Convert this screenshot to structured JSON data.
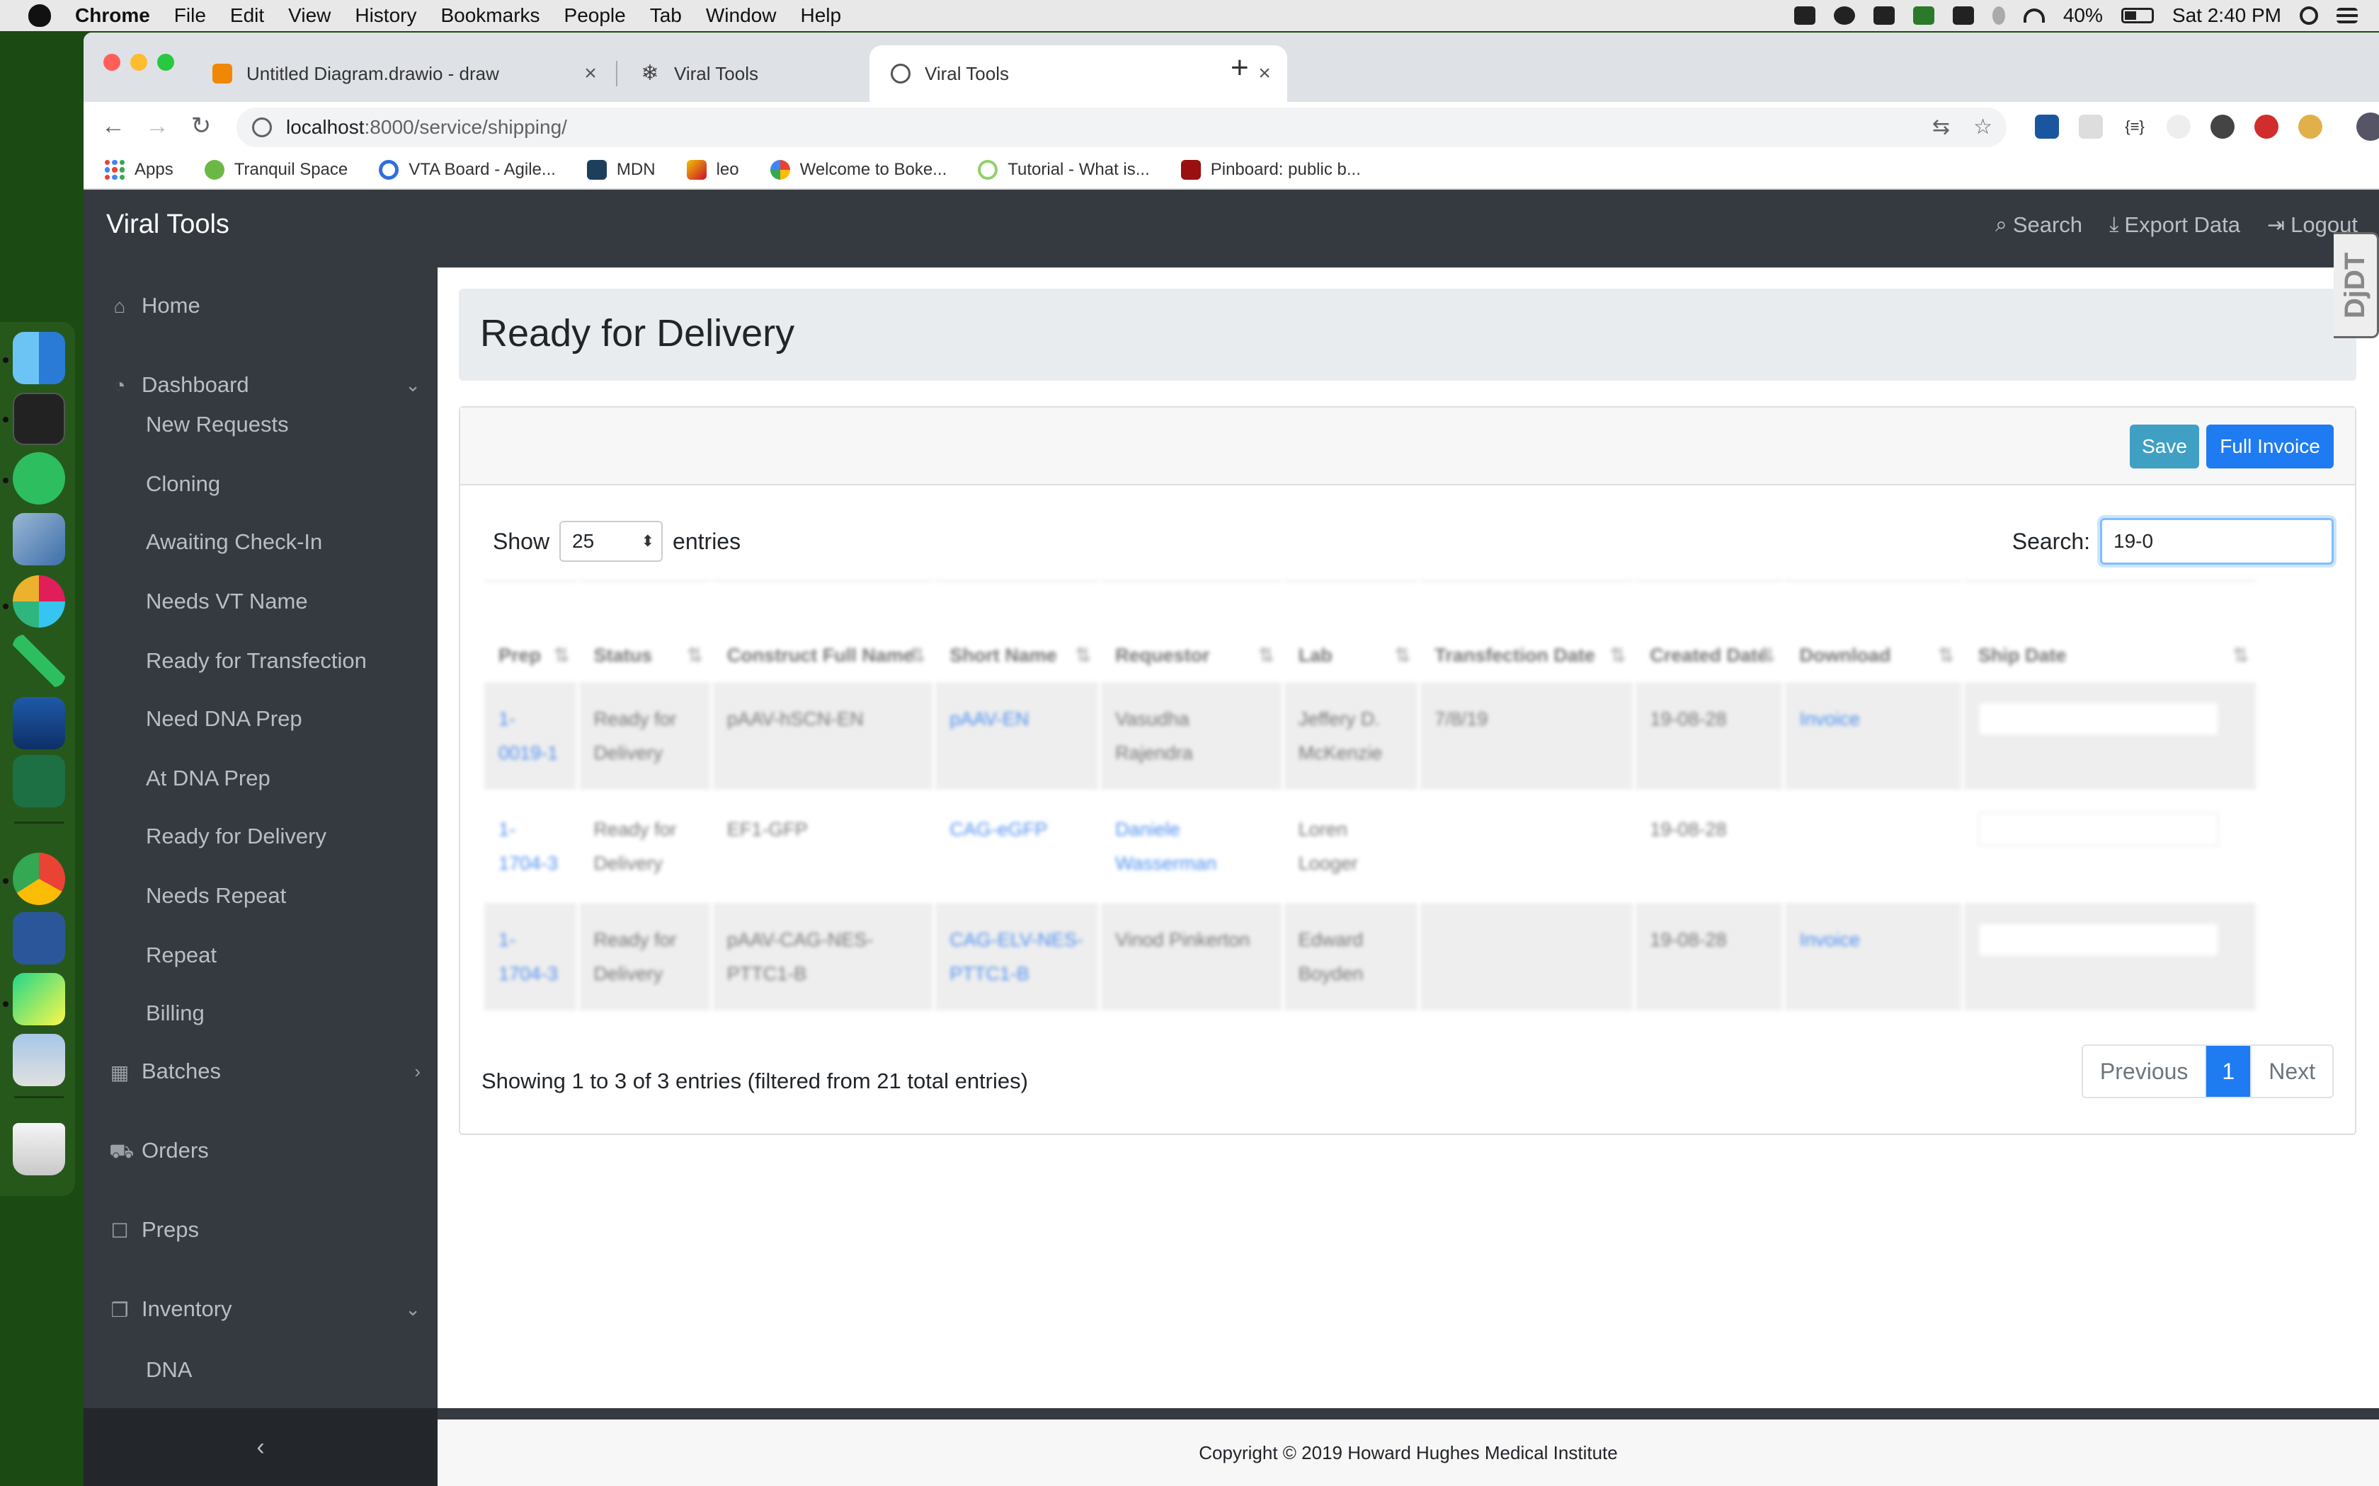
{
  "menubar": {
    "app": "Chrome",
    "items": [
      "File",
      "Edit",
      "View",
      "History",
      "Bookmarks",
      "People",
      "Tab",
      "Window",
      "Help"
    ],
    "battery": "40%",
    "clock": "Sat 2:40 PM"
  },
  "browser": {
    "tabs": [
      {
        "label": "Untitled Diagram.drawio - draw"
      },
      {
        "label": "Viral Tools"
      },
      {
        "label": "Viral Tools"
      }
    ],
    "url_host": "localhost",
    "url_path": ":8000/service/shipping/",
    "bookmarks": [
      "Apps",
      "Tranquil Space",
      "VTA Board - Agile...",
      "MDN",
      "leo",
      "Welcome to Boke...",
      "Tutorial - What is...",
      "Pinboard: public b..."
    ]
  },
  "app": {
    "brand": "Viral Tools",
    "nav": {
      "search": "Search",
      "export": "Export Data",
      "logout": "Logout"
    },
    "ddt": "DjDT"
  },
  "sidebar": {
    "home": "Home",
    "dashboard": "Dashboard",
    "dashboard_items": [
      "New Requests",
      "Cloning",
      "Awaiting Check-In",
      "Needs VT Name",
      "Ready for Transfection",
      "Need DNA Prep",
      "At DNA Prep",
      "Ready for Delivery",
      "Needs Repeat",
      "Repeat",
      "Billing"
    ],
    "batches": "Batches",
    "orders": "Orders",
    "preps": "Preps",
    "inventory": "Inventory",
    "inventory_items": [
      "DNA"
    ],
    "collapse": "‹"
  },
  "page": {
    "title": "Ready for Delivery",
    "save": "Save",
    "full_invoice": "Full Invoice",
    "show_label": "Show",
    "page_length": "25",
    "entries_label": "entries",
    "search_label": "Search:",
    "search_value": "19-0",
    "table": {
      "headers": [
        "Prep",
        "Status",
        "Construct Full Name",
        "Short Name",
        "Requestor",
        "Lab",
        "Transfection Date",
        "Created Date",
        "Download",
        "Ship Date"
      ],
      "rows": [
        [
          "1-0019-1",
          "Ready for Delivery",
          "pAAV-hSCN-EN",
          "pAAV-EN",
          "Vasudha Rajendra",
          "Jeffery D. McKenzie",
          "7/8/19",
          "19-08-28",
          "Invoice",
          ""
        ],
        [
          "1-1704-3",
          "Ready for Delivery",
          "EF1-GFP",
          "CAG-eGFP",
          "Daniele Wasserman",
          "Loren Looger",
          "",
          "19-08-28",
          "",
          ""
        ],
        [
          "1-1704-3",
          "Ready for Delivery",
          "pAAV-CAG-NES-PTTC1-B",
          "CAG-ELV-NES-PTTC1-B",
          "Vinod Pinkerton",
          "Edward Boyden",
          "",
          "19-08-28",
          "Invoice",
          ""
        ]
      ]
    },
    "info": "Showing 1 to 3 of 3 entries (filtered from 21 total entries)",
    "pager": {
      "prev": "Previous",
      "current": "1",
      "next": "Next"
    }
  },
  "footer": "Copyright © 2019 Howard Hughes Medical Institute"
}
